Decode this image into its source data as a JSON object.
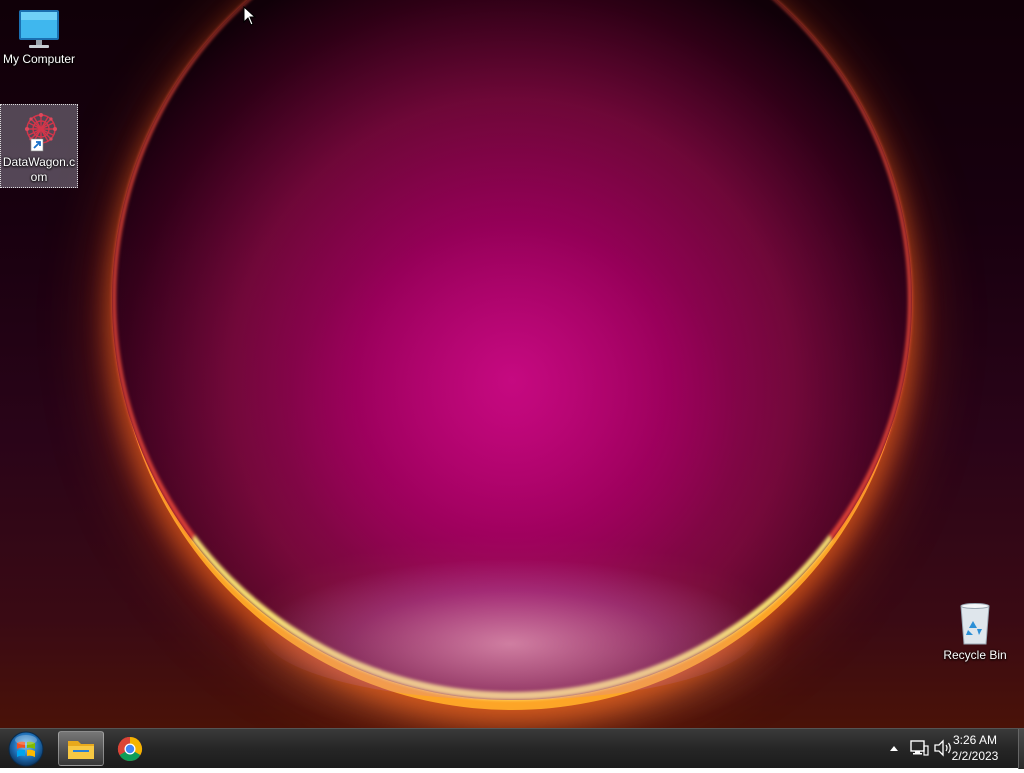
{
  "desktop": {
    "icons": [
      {
        "label": "My Computer",
        "icon": "monitor-icon"
      },
      {
        "label": "DataWagon.com",
        "icon": "datawagon-shortcut-icon",
        "selected": true
      },
      {
        "label": "Recycle Bin",
        "icon": "recycle-bin-icon"
      }
    ]
  },
  "taskbar": {
    "start_icon": "windows-start-orb-icon",
    "pinned": [
      {
        "name": "File Explorer",
        "icon": "folder-icon",
        "active": true
      },
      {
        "name": "Google Chrome",
        "icon": "chrome-icon",
        "active": false
      }
    ],
    "tray": {
      "icons": [
        "show-hidden-icons-arrow-icon",
        "network-icon",
        "volume-icon"
      ],
      "time": "3:26 AM",
      "date": "2/2/2023"
    }
  },
  "colors": {
    "taskbar": "#262626",
    "wallpaper_accent": "#c8007e",
    "wallpaper_rim": "#ffd040"
  }
}
